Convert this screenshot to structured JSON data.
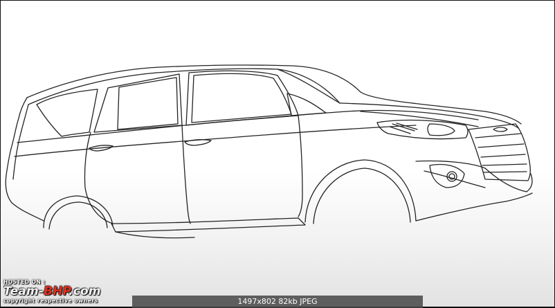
{
  "image": {
    "subject": "line-drawing-of-mpv-side-view",
    "background_color": "#ffffff",
    "line_color": "#222222"
  },
  "watermark": {
    "hosted_on": "HOSTED ON :",
    "brand_prefix": "Team-",
    "brand_accent": "BHP",
    "brand_suffix": ".com",
    "copyright": "copyright respective owners",
    "accent_color": "#e8301e"
  },
  "image_info": {
    "text": "1497x802  82kb  JPEG"
  }
}
